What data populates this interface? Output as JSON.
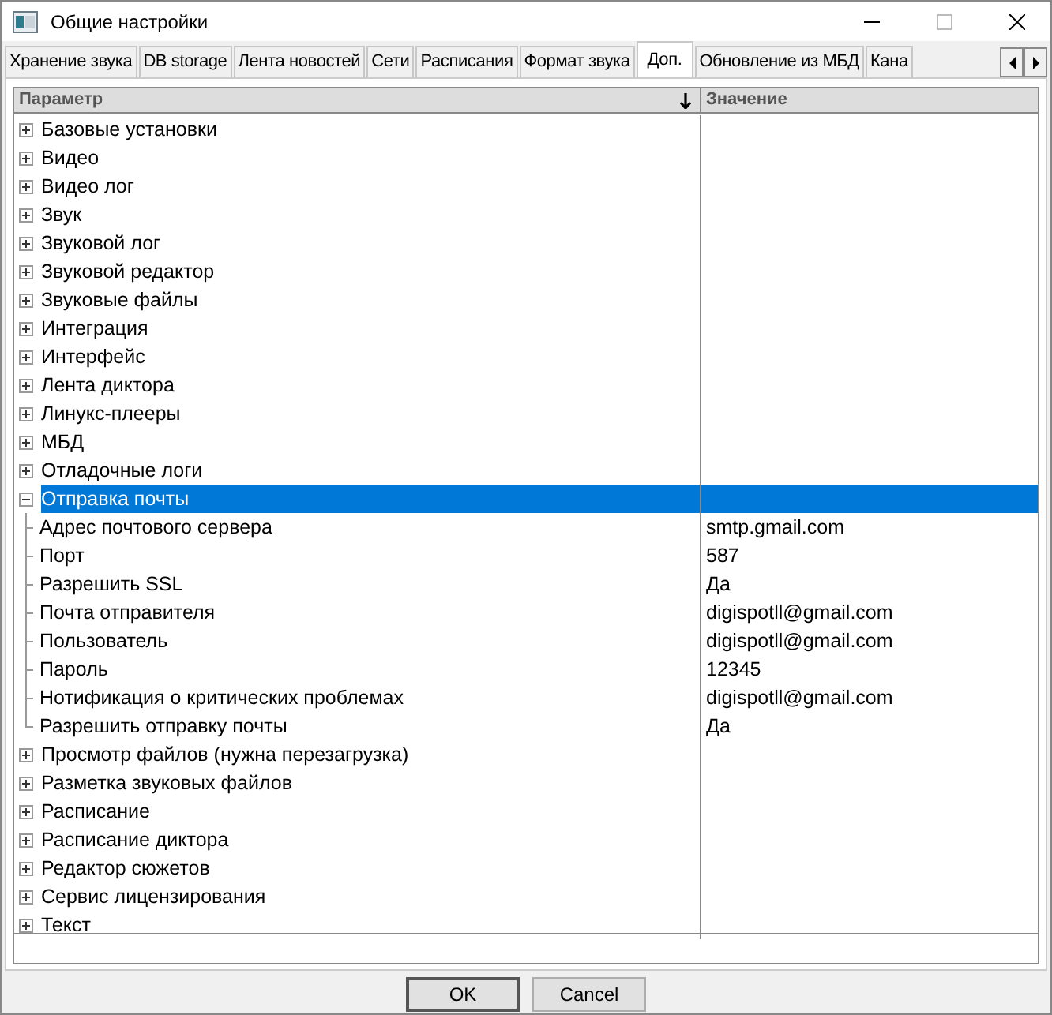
{
  "window": {
    "title": "Общие настройки"
  },
  "tabs": [
    {
      "label": "Хранение звука",
      "selected": false
    },
    {
      "label": "DB storage",
      "selected": false
    },
    {
      "label": "Лента новостей",
      "selected": false
    },
    {
      "label": "Сети",
      "selected": false
    },
    {
      "label": "Расписания",
      "selected": false
    },
    {
      "label": "Формат звука",
      "selected": false
    },
    {
      "label": "Доп.",
      "selected": true
    },
    {
      "label": "Обновление из МБД",
      "selected": false
    },
    {
      "label": "Кана",
      "selected": false
    }
  ],
  "grid": {
    "columns": [
      "Параметр",
      "Значение"
    ],
    "groups": [
      {
        "name": "Базовые установки",
        "expanded": false,
        "selected": false
      },
      {
        "name": "Видео",
        "expanded": false,
        "selected": false
      },
      {
        "name": "Видео лог",
        "expanded": false,
        "selected": false
      },
      {
        "name": "Звук",
        "expanded": false,
        "selected": false
      },
      {
        "name": "Звуковой лог",
        "expanded": false,
        "selected": false
      },
      {
        "name": "Звуковой редактор",
        "expanded": false,
        "selected": false
      },
      {
        "name": "Звуковые файлы",
        "expanded": false,
        "selected": false
      },
      {
        "name": "Интеграция",
        "expanded": false,
        "selected": false
      },
      {
        "name": "Интерфейс",
        "expanded": false,
        "selected": false
      },
      {
        "name": "Лента диктора",
        "expanded": false,
        "selected": false
      },
      {
        "name": "Линукс-плееры",
        "expanded": false,
        "selected": false
      },
      {
        "name": "МБД",
        "expanded": false,
        "selected": false
      },
      {
        "name": "Отладочные логи",
        "expanded": false,
        "selected": false
      },
      {
        "name": "Отправка почты",
        "expanded": true,
        "selected": true,
        "children": [
          {
            "name": "Адрес почтового сервера",
            "value": "smtp.gmail.com"
          },
          {
            "name": "Порт",
            "value": "587"
          },
          {
            "name": "Разрешить SSL",
            "value": "Да"
          },
          {
            "name": "Почта отправителя",
            "value": "digispotll@gmail.com"
          },
          {
            "name": "Пользователь",
            "value": "digispotll@gmail.com"
          },
          {
            "name": "Пароль",
            "value": "12345"
          },
          {
            "name": "Нотификация о критических проблемах",
            "value": "digispotll@gmail.com"
          },
          {
            "name": "Разрешить отправку почты",
            "value": "Да"
          }
        ]
      },
      {
        "name": "Просмотр файлов (нужна перезагрузка)",
        "expanded": false,
        "selected": false
      },
      {
        "name": "Разметка звуковых файлов",
        "expanded": false,
        "selected": false
      },
      {
        "name": "Расписание",
        "expanded": false,
        "selected": false
      },
      {
        "name": "Расписание диктора",
        "expanded": false,
        "selected": false
      },
      {
        "name": "Редактор сюжетов",
        "expanded": false,
        "selected": false
      },
      {
        "name": "Сервис лицензирования",
        "expanded": false,
        "selected": false
      },
      {
        "name": "Текст",
        "expanded": false,
        "selected": false
      }
    ]
  },
  "buttons": [
    "OK",
    "Cancel"
  ]
}
